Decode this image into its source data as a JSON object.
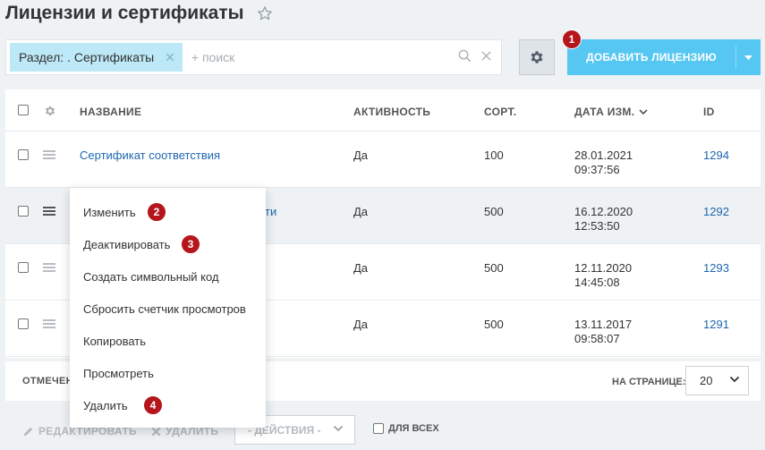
{
  "page": {
    "title": "Лицензии и сертификаты"
  },
  "filter": {
    "tag_label": "Раздел: . Сертификаты",
    "plus_label": "+ поиск"
  },
  "toolbar": {
    "add_label": "ДОБАВИТЬ ЛИЦЕНЗИЮ"
  },
  "table": {
    "columns": [
      "НАЗВАНИЕ",
      "АКТИВНОСТЬ",
      "СОРТ.",
      "ДАТА ИЗМ.",
      "ID"
    ],
    "rows": [
      {
        "name": "Сертификат соответствия",
        "active": "Да",
        "sort": "100",
        "date": "28.01.2021",
        "time": "09:37:56",
        "id": "1294"
      },
      {
        "name": "ти",
        "active": "Да",
        "sort": "500",
        "date": "16.12.2020",
        "time": "12:53:50",
        "id": "1292"
      },
      {
        "name": "",
        "active": "Да",
        "sort": "500",
        "date": "12.11.2020",
        "time": "14:45:08",
        "id": "1293"
      },
      {
        "name": "",
        "active": "Да",
        "sort": "500",
        "date": "13.11.2017",
        "time": "09:58:07",
        "id": "1291"
      }
    ]
  },
  "footer": {
    "selected_label": "ОТМЕЧЕН",
    "per_page_label": "НА СТРАНИЦЕ:",
    "per_page_value": "20"
  },
  "actions": {
    "edit": "РЕДАКТИРОВАТЬ",
    "delete": "УДАЛИТЬ",
    "select": "- ДЕЙСТВИЯ -",
    "for_all": "ДЛЯ ВСЕХ"
  },
  "context_menu": {
    "items": [
      "Изменить",
      "Деактивировать",
      "Создать символьный код",
      "Сбросить счетчик просмотров",
      "Копировать",
      "Просмотреть",
      "Удалить"
    ]
  },
  "badges": [
    "1",
    "2",
    "3",
    "4"
  ],
  "colors": {
    "accent": "#56c7f2",
    "badge": "#b5161c",
    "link": "#2067b0",
    "tag": "#bde8f7"
  }
}
